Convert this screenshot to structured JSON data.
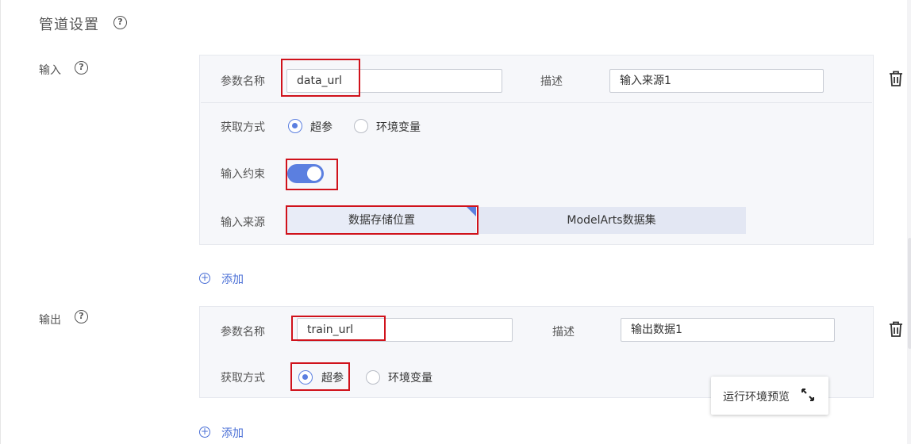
{
  "section": {
    "title": "管道设置"
  },
  "input": {
    "label": "输入",
    "param_name_label": "参数名称",
    "param_name_value": "data_url",
    "desc_label": "描述",
    "desc_value": "输入来源1",
    "acquire_label": "获取方式",
    "acquire_options": [
      "超参",
      "环境变量"
    ],
    "acquire_selected": "超参",
    "constraint_label": "输入约束",
    "constraint_enabled": true,
    "source_label": "输入来源",
    "source_options": [
      "数据存储位置",
      "ModelArts数据集"
    ],
    "source_selected": "数据存储位置",
    "add_label": "添加"
  },
  "output": {
    "label": "输出",
    "param_name_label": "参数名称",
    "param_name_value": "train_url",
    "desc_label": "描述",
    "desc_value": "输出数据1",
    "acquire_label": "获取方式",
    "acquire_options": [
      "超参",
      "环境变量"
    ],
    "acquire_selected": "超参",
    "add_label": "添加"
  },
  "preview": {
    "label": "运行环境预览"
  },
  "icons": {
    "help": "question-circle-icon",
    "delete": "trash-icon",
    "add": "plus-circle-icon",
    "expand": "expand-arrows-icon"
  },
  "colors": {
    "accent": "#5b7fe0",
    "link": "#4a6fd6",
    "highlight": "#d0121b"
  }
}
